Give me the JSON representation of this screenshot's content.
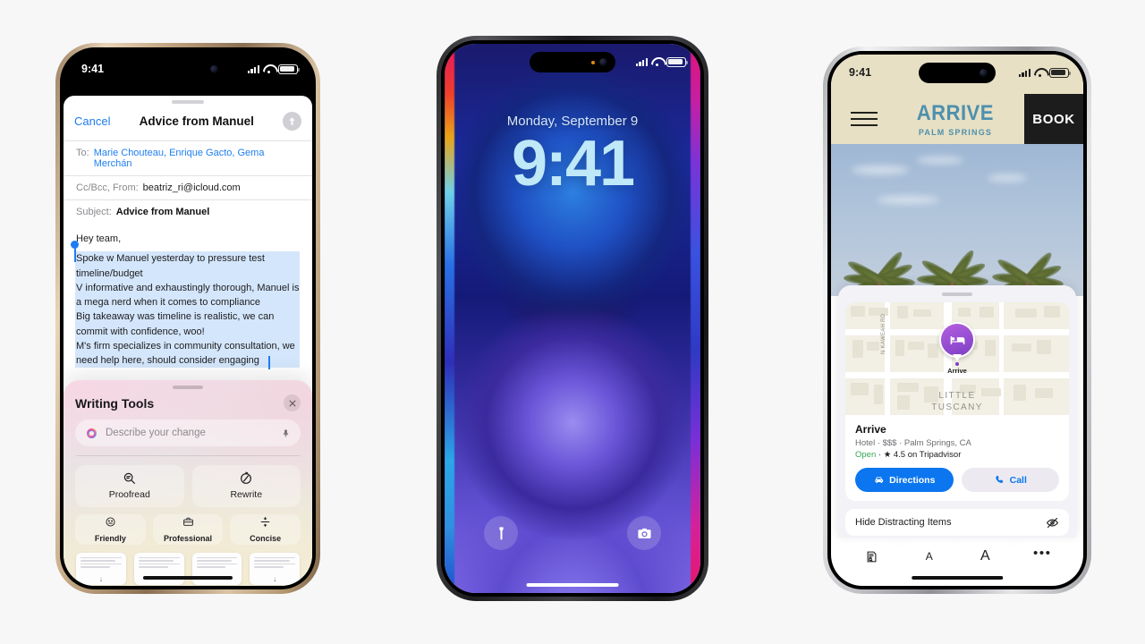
{
  "background_color": "#f7f7f7",
  "phones": [
    {
      "name": "mail-writing-tools",
      "frame_finish": "gold-titanium",
      "status_bar": {
        "time": "9:41",
        "signal_icon": "cellular-bars-icon",
        "wifi_icon": "wifi-icon",
        "battery_icon": "battery-icon"
      },
      "mail": {
        "cancel_label": "Cancel",
        "title": "Advice from Manuel",
        "send_icon": "send-arrow-up-icon",
        "to_label": "To:",
        "to_value": "Marie Chouteau, Enrique Gacto, Gema Merchán",
        "ccbcc_label": "Cc/Bcc, From:",
        "from_value": "beatriz_ri@icloud.com",
        "subject_label": "Subject:",
        "subject_value": "Advice from Manuel",
        "greeting": "Hey team,",
        "selected_lines": [
          "Spoke w Manuel yesterday to pressure test timeline/budget",
          "V informative and exhaustingly thorough, Manuel is a mega nerd when it comes to compliance",
          "Big takeaway was timeline is realistic, we can commit with confidence, woo!",
          "M's firm specializes in community consultation, we need help here, should consider engaging"
        ],
        "selection_color": "#d4e6fb",
        "caret_color": "#1e7ef0"
      },
      "writing_tools": {
        "title": "Writing Tools",
        "close_icon": "close-x-icon",
        "input_placeholder": "Describe your change",
        "orb_icon": "apple-intelligence-orb-icon",
        "mic_icon": "microphone-icon",
        "primary_actions": [
          {
            "label": "Proofread",
            "icon": "proofread-magnifier-icon"
          },
          {
            "label": "Rewrite",
            "icon": "rewrite-circular-arrow-icon"
          }
        ],
        "tone_actions": [
          {
            "label": "Friendly",
            "icon": "smiley-face-icon"
          },
          {
            "label": "Professional",
            "icon": "briefcase-icon"
          },
          {
            "label": "Concise",
            "icon": "concise-compress-icon"
          }
        ],
        "summary_cards": [
          {
            "icon": "download-arrow-icon"
          },
          {
            "icon": ""
          },
          {
            "icon": ""
          },
          {
            "icon": "download-arrow-icon"
          }
        ]
      }
    },
    {
      "name": "lock-screen",
      "frame_finish": "black-titanium",
      "status_bar": {
        "time": "",
        "signal_icon": "cellular-bars-icon",
        "wifi_icon": "wifi-icon",
        "battery_icon": "battery-icon"
      },
      "lock": {
        "date": "Monday, September 9",
        "time": "9:41",
        "date_color": "#d5e5f7",
        "time_color": "#bfe8f8",
        "left_button_icon": "flashlight-icon",
        "right_button_icon": "camera-icon"
      }
    },
    {
      "name": "safari-arrive-palm-springs",
      "frame_finish": "white-titanium",
      "status_bar": {
        "time": "9:41",
        "signal_icon": "cellular-bars-icon",
        "wifi_icon": "wifi-icon",
        "battery_icon": "battery-icon"
      },
      "site": {
        "menu_icon": "hamburger-menu-icon",
        "brand_line1": "ARRIVE",
        "brand_line2": "PALM SPRINGS",
        "brand_color": "#4d90ad",
        "header_bg": "#e7e0c4",
        "book_label": "BOOK"
      },
      "poi": {
        "map_pin_icon": "hotel-bed-icon",
        "pin_label": "Arrive",
        "street_label": "N KAWEAH RD",
        "neighborhood_line1": "LITTLE",
        "neighborhood_line2": "TUSCANY",
        "name": "Arrive",
        "meta": "Hotel · $$$ · Palm Springs, CA",
        "open_label": "Open",
        "rating_text": "· ★ 4.5 on Tripadvisor",
        "open_color": "#34a853",
        "actions": [
          {
            "label": "Directions",
            "icon": "car-icon",
            "style": "primary",
            "accent": "#0b76ef"
          },
          {
            "label": "Call",
            "icon": "phone-handset-icon",
            "style": "secondary"
          }
        ]
      },
      "safari_menu": {
        "hide_distracting_label": "Hide Distracting Items",
        "hide_distracting_icon": "eye-slash-icon",
        "tools": [
          {
            "icon": "reader-view-icon",
            "label": ""
          },
          {
            "icon": "text-size-small-icon",
            "label": "A"
          },
          {
            "icon": "text-size-large-icon",
            "label": "A"
          },
          {
            "icon": "more-ellipsis-icon",
            "label": ""
          }
        ]
      }
    }
  ]
}
